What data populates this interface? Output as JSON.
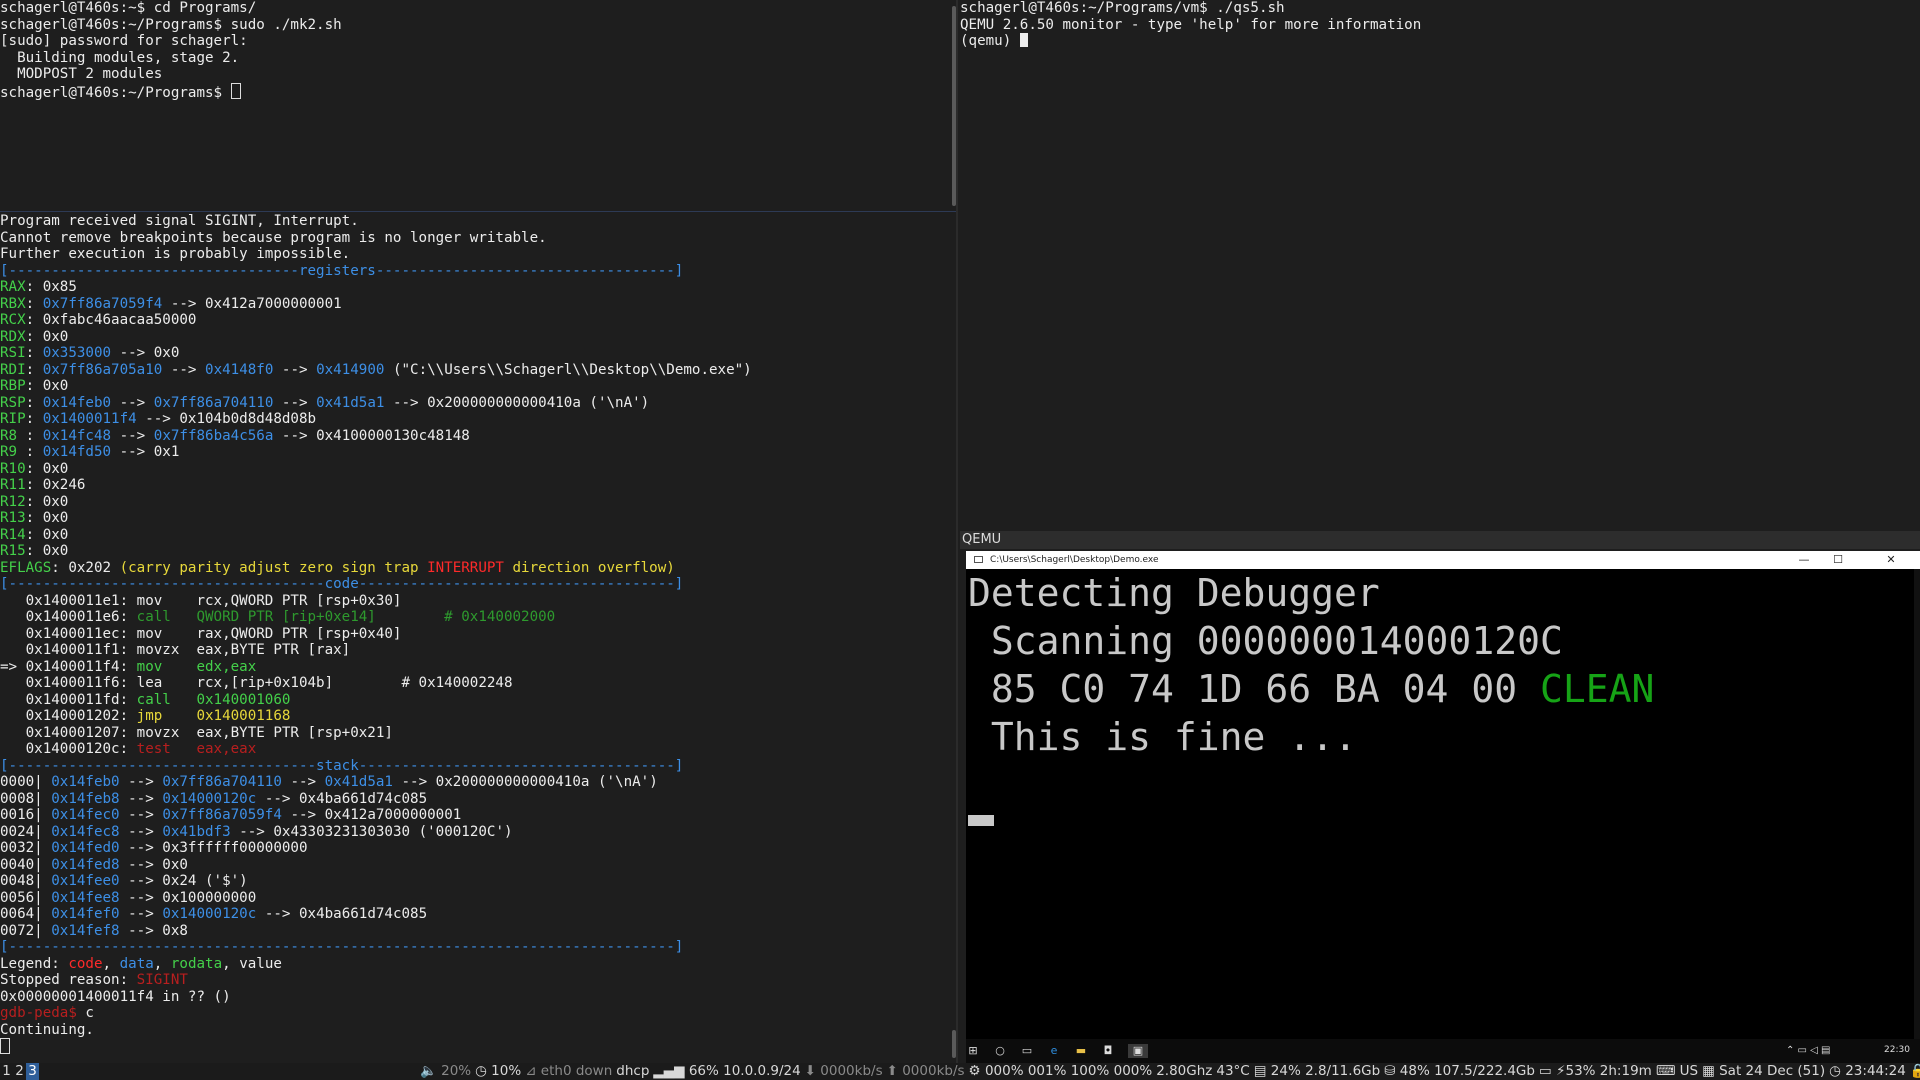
{
  "terminal_top_left": {
    "lines": [
      "schagerl@T460s:~$ cd Programs/",
      "schagerl@T460s:~/Programs$ sudo ./mk2.sh",
      "[sudo] password for schagerl:",
      "  Building modules, stage 2.",
      "  MODPOST 2 modules",
      "schagerl@T460s:~/Programs$ "
    ]
  },
  "gdb": {
    "intro": [
      "Program received signal SIGINT, Interrupt.",
      "Cannot remove breakpoints because program is no longer writable.",
      "Further execution is probably impossible."
    ],
    "sep_registers": "[----------------------------------registers-----------------------------------]",
    "registers": [
      {
        "name": "RAX",
        "sep": ": ",
        "val": "0x85"
      },
      {
        "name": "RBX",
        "sep": ": ",
        "p1": "0x7ff86a7059f4",
        "rest": " --> 0x412a7000000001"
      },
      {
        "name": "RCX",
        "sep": ": ",
        "val": "0xfabc46aacaa50000"
      },
      {
        "name": "RDX",
        "sep": ": ",
        "val": "0x0"
      },
      {
        "name": "RSI",
        "sep": ": ",
        "p1": "0x353000",
        "rest": " --> 0x0"
      },
      {
        "name": "RDI",
        "sep": ": ",
        "p1": "0x7ff86a705a10",
        "a1": " --> ",
        "p2": "0x4148f0",
        "a2": " --> ",
        "p3": "0x414900",
        "rest": " (\"C:\\\\Users\\\\Schagerl\\\\Desktop\\\\Demo.exe\")"
      },
      {
        "name": "RBP",
        "sep": ": ",
        "val": "0x0"
      },
      {
        "name": "RSP",
        "sep": ": ",
        "p1": "0x14feb0",
        "a1": " --> ",
        "p2": "0x7ff86a704110",
        "a2": " --> ",
        "p3": "0x41d5a1",
        "rest": " --> 0x200000000000410a ('\\nA')"
      },
      {
        "name": "RIP",
        "sep": ": ",
        "p1": "0x1400011f4",
        "rest": " --> 0x104b0d8d48d08b"
      },
      {
        "name": "R8 ",
        "sep": ": ",
        "p1": "0x14fc48",
        "a1": " --> ",
        "p2": "0x7ff86ba4c56a",
        "rest": " --> 0x4100000130c48148"
      },
      {
        "name": "R9 ",
        "sep": ": ",
        "p1": "0x14fd50",
        "rest": " --> 0x1"
      },
      {
        "name": "R10",
        "sep": ": ",
        "val": "0x0"
      },
      {
        "name": "R11",
        "sep": ": ",
        "val": "0x246"
      },
      {
        "name": "R12",
        "sep": ": ",
        "val": "0x0"
      },
      {
        "name": "R13",
        "sep": ": ",
        "val": "0x0"
      },
      {
        "name": "R14",
        "sep": ": ",
        "val": "0x0"
      },
      {
        "name": "R15",
        "sep": ": ",
        "val": "0x0"
      }
    ],
    "eflags": {
      "name": "EFLAGS",
      "value": ": 0x202 ",
      "open": "(carry parity adjust zero sign trap ",
      "flag": "INTERRUPT",
      "close": " direction overflow)"
    },
    "sep_code": "[-------------------------------------code-------------------------------------]",
    "code": [
      {
        "prefix": "   ",
        "addr": "0x1400011e1:",
        "op": " mov    ",
        "args": "rcx,QWORD PTR [rsp+0x30]",
        "style": "w"
      },
      {
        "prefix": "   ",
        "addr": "0x1400011e6:",
        "op": " call   ",
        "args": "QWORD PTR [rip+0xe14]",
        "comment": "        # 0x140002000",
        "style": "dg"
      },
      {
        "prefix": "   ",
        "addr": "0x1400011ec:",
        "op": " mov    ",
        "args": "rax,QWORD PTR [rsp+0x40]",
        "style": "w"
      },
      {
        "prefix": "   ",
        "addr": "0x1400011f1:",
        "op": " movzx  ",
        "args": "eax,BYTE PTR [rax]",
        "style": "w"
      },
      {
        "prefix": "=> ",
        "addr": "0x1400011f4:",
        "op": " mov    ",
        "args": "edx,eax",
        "style": "cur"
      },
      {
        "prefix": "   ",
        "addr": "0x1400011f6:",
        "op": " lea    ",
        "args": "rcx,[rip+0x104b]",
        "comment": "        # 0x140002248",
        "style": "w"
      },
      {
        "prefix": "   ",
        "addr": "0x1400011fd:",
        "op": " call   ",
        "args": "0x140001060",
        "style": "gcall"
      },
      {
        "prefix": "   ",
        "addr": "0x140001202:",
        "op": " jmp    ",
        "args": "0x140001168",
        "style": "jmp"
      },
      {
        "prefix": "   ",
        "addr": "0x140001207:",
        "op": " movzx  ",
        "args": "eax,BYTE PTR [rsp+0x21]",
        "style": "w"
      },
      {
        "prefix": "   ",
        "addr": "0x14000120c:",
        "op": " test   ",
        "args": "eax,eax",
        "style": "dr"
      }
    ],
    "sep_stack": "[------------------------------------stack-------------------------------------]",
    "stack": [
      {
        "off": "0000| ",
        "p1": "0x14feb0",
        "a1": " --> ",
        "p2": "0x7ff86a704110",
        "a2": " --> ",
        "p3": "0x41d5a1",
        "rest": " --> 0x200000000000410a ('\\nA')"
      },
      {
        "off": "0008| ",
        "p1": "0x14feb8",
        "a1": " --> ",
        "p2": "0x14000120c",
        "rest": " --> 0x4ba661d74c085"
      },
      {
        "off": "0016| ",
        "p1": "0x14fec0",
        "a1": " --> ",
        "p2": "0x7ff86a7059f4",
        "rest": " --> 0x412a7000000001"
      },
      {
        "off": "0024| ",
        "p1": "0x14fec8",
        "a1": " --> ",
        "p2": "0x41bdf3",
        "rest": " --> 0x43303231303030 ('000120C')"
      },
      {
        "off": "0032| ",
        "p1": "0x14fed0",
        "rest": " --> 0x3ffffff00000000"
      },
      {
        "off": "0040| ",
        "p1": "0x14fed8",
        "rest": " --> 0x0"
      },
      {
        "off": "0048| ",
        "p1": "0x14fee0",
        "rest": " --> 0x24 ('$')"
      },
      {
        "off": "0056| ",
        "p1": "0x14fee8",
        "rest": " --> 0x100000000"
      },
      {
        "off": "0064| ",
        "p1": "0x14fef0",
        "a1": " --> ",
        "p2": "0x14000120c",
        "rest": " --> 0x4ba661d74c085"
      },
      {
        "off": "0072| ",
        "p1": "0x14fef8",
        "rest": " --> 0x8"
      }
    ],
    "sep_end": "[------------------------------------------------------------------------------]",
    "legend": {
      "label": "Legend: ",
      "code": "code",
      "c1": ", ",
      "data": "data",
      "c2": ", ",
      "rodata": "rodata",
      "c3": ", ",
      "value": "value"
    },
    "stopped": {
      "label": "Stopped reason: ",
      "reason": "SIGINT"
    },
    "location": "0x00000001400011f4 in ?? ()",
    "prompt": "gdb-peda$",
    "command": " c",
    "continuing": "Continuing."
  },
  "terminal_top_right": {
    "lines": [
      "schagerl@T460s:~/Programs/vm$ ./qs5.sh",
      "QEMU 2.6.50 monitor - type 'help' for more information"
    ],
    "prompt": "(qemu) "
  },
  "qemu": {
    "window_title": "QEMU",
    "guest_window_title": "C:\\Users\\Schagerl\\Desktop\\Demo.exe",
    "min_icon": "—",
    "max_icon": "☐",
    "close_icon": "✕",
    "console": {
      "line1": "Detecting Debugger",
      "line2": " Scanning 000000014000120C",
      "line3": " 85 C0 74 1D 66 BA 04 00 ",
      "line3_status": "CLEAN",
      "line4": " This is fine ..."
    },
    "taskbar": {
      "start": "⊞",
      "search": "○",
      "taskview": "▭",
      "edge": "e",
      "explorer": "▬",
      "store": "◘",
      "console_app": "▣",
      "tray": "⌃ ▭ ◁ ▤",
      "clock": "22:30"
    }
  },
  "statusbar": {
    "workspaces": [
      "1",
      "2",
      "3"
    ],
    "active_workspace": "3",
    "items": [
      {
        "text": "🔈 20%",
        "dim": true
      },
      {
        "text": "◷ 10%"
      },
      {
        "text": "⊿ eth0 down",
        "dim": true
      },
      {
        "text": "dhcp"
      },
      {
        "text": "▂▄▆ 66% 10.0.0.9/24"
      },
      {
        "text": "⬇ 0000kb/s",
        "dim": true
      },
      {
        "text": "⬆ 0000kb/s",
        "dim": true
      },
      {
        "text": "⚙ 000% 001% 100% 000%"
      },
      {
        "text": "2.80Ghz"
      },
      {
        "text": "43°C"
      },
      {
        "text": "▤ 24% 2.8/11.6Gb"
      },
      {
        "text": "⛁ 48% 107.5/222.4Gb"
      },
      {
        "text": "▭ ⚡53% 2h:19m"
      },
      {
        "text": "⌨ US"
      },
      {
        "text": "▦ Sat 24 Dec (51)"
      },
      {
        "text": "◷ 23:44:24"
      },
      {
        "text": "🔒"
      }
    ]
  }
}
